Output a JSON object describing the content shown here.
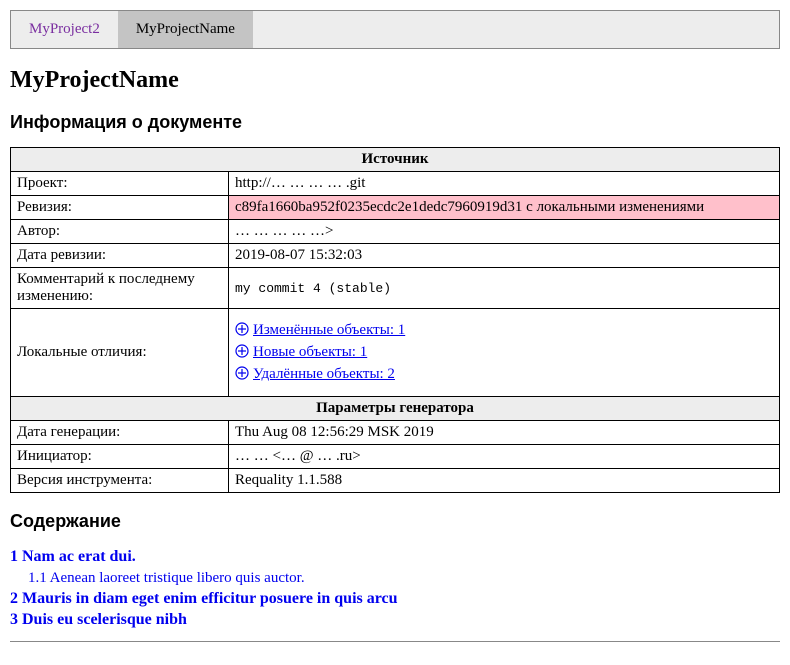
{
  "tabs": {
    "inactive": "MyProject2",
    "active": "MyProjectName"
  },
  "project_title": "MyProjectName",
  "section_info": "Информация о документе",
  "table": {
    "source_header": "Источник",
    "rows": {
      "project_label": "Проект:",
      "project_value": "http://… … … … .git",
      "revision_label": "Ревизия:",
      "revision_value": "c89fa1660ba952f0235ecdc2e1dedc7960919d31 с локальными изменениями",
      "author_label": "Автор:",
      "author_value": "… … … … …>",
      "revdate_label": "Дата ревизии:",
      "revdate_value": "2019-08-07 15:32:03",
      "comment_label": "Комментарий к последнему изменению:",
      "comment_value": "my commit 4 (stable)",
      "localdiff_label": "Локальные отличия:",
      "diffs": {
        "changed": "Изменённые объекты: 1",
        "new": "Новые объекты: 1",
        "deleted": "Удалённые объекты: 2"
      }
    },
    "gen_header": "Параметры генератора",
    "gen": {
      "date_label": "Дата генерации:",
      "date_value": "Thu Aug 08 12:56:29 MSK 2019",
      "initiator_label": "Инициатор:",
      "initiator_value": "… … <… @ … .ru>",
      "version_label": "Версия инструмента:",
      "version_value": "Requality 1.1.588"
    }
  },
  "section_toc": "Содержание",
  "toc": [
    {
      "level": 1,
      "text": "1 Nam ac erat dui."
    },
    {
      "level": 2,
      "text": "1.1 Aenean laoreet tristique libero quis auctor."
    },
    {
      "level": 1,
      "text": "2 Mauris in diam eget enim efficitur posuere in quis arcu"
    },
    {
      "level": 1,
      "text": "3 Duis eu scelerisque nibh"
    }
  ]
}
